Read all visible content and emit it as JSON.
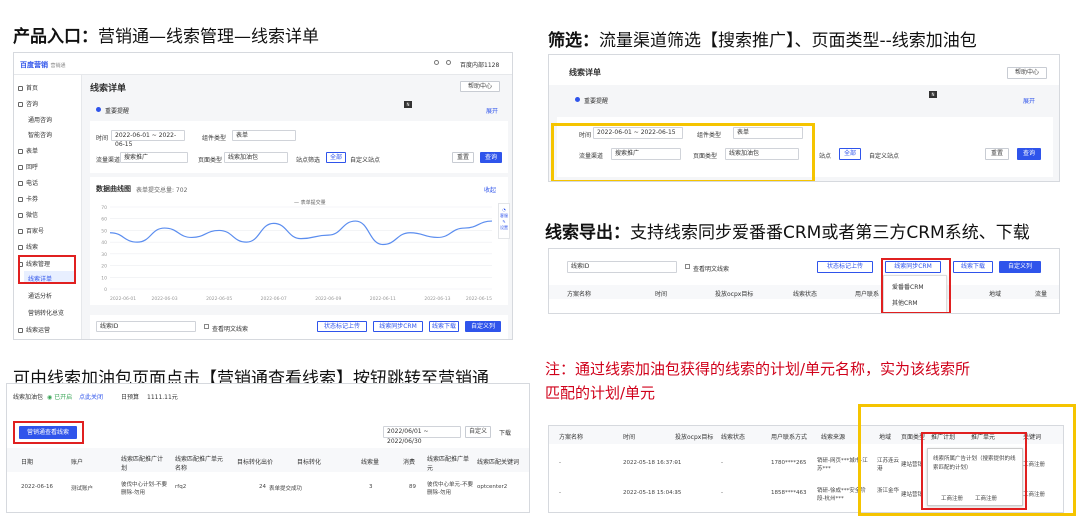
{
  "headings": {
    "product_entry_label": "产品入口：",
    "product_entry_path": "营销通—线索管理—线索详单",
    "filter_label": "筛选：",
    "filter_desc": "流量渠道筛选【搜索推广】、页面类型--线索加油包",
    "export_label": "线索导出：",
    "export_desc": "支持线索同步爱番番CRM或者第三方CRM系统、下载",
    "jump_desc": "可由线索加油包页面点击【营销通查看线索】按钮跳转至营销通",
    "note_line1": "注：通过线索加油包获得的线索的计划/单元名称，实为该线索所",
    "note_line2": "匹配的计划/单元"
  },
  "main_shot": {
    "logo": "百度营销",
    "logo_sub": "营销通",
    "user": "百度内部1128",
    "help": "帮助中心",
    "title": "线索详单",
    "notice": "重要提醒",
    "expand": "展开",
    "nav": [
      "首页",
      "咨询",
      "通用咨询",
      "智能咨询",
      "表单",
      "回呼",
      "电话",
      "卡券",
      "微信",
      "百家号",
      "线索",
      "线索管理",
      "线索详单",
      "通话分析",
      "营销转化总览",
      "线索运营"
    ],
    "filters": {
      "time_label": "时间",
      "time_value": "2022-06-01 ~ 2022-06-15",
      "component_label": "组件类型",
      "component_value": "表单",
      "channel_label": "流量渠道",
      "channel_value": "搜索推广",
      "page_type_label": "页面类型",
      "page_type_value": "线索加油包",
      "site_label": "站点筛选",
      "site_all": "全部",
      "site_custom": "自定义站点",
      "reset": "重置",
      "query": "查询"
    },
    "chart": {
      "title": "数据曲线图",
      "subtitle": "表单提交总量: 702",
      "collapse": "收起",
      "legend": "表单提交量",
      "side_a": "客服",
      "side_b": "设置"
    },
    "toolbar": {
      "search_select": "线索ID",
      "view_plain": "查看明文线索",
      "status": "状态标记上传",
      "sync": "线索同步CRM",
      "download": "线索下载",
      "custom": "自定义列"
    }
  },
  "chart_data": {
    "type": "line",
    "title": "",
    "x": [
      "2022-06-01",
      "2022-06-03",
      "2022-06-05",
      "2022-06-07",
      "2022-06-09",
      "2022-06-11",
      "2022-06-13",
      "2022-06-15"
    ],
    "series": [
      {
        "name": "表单提交量",
        "values": [
          48,
          40,
          52,
          44,
          50,
          40,
          56,
          43,
          46,
          58,
          38,
          48,
          44,
          52,
          58
        ]
      }
    ],
    "ylim": [
      0,
      70
    ],
    "yticks": [
      0,
      10,
      20,
      30,
      40,
      50,
      60,
      70
    ],
    "grid": true,
    "legend": "top"
  },
  "filter_shot": {
    "title": "线索详单",
    "help": "帮助中心",
    "notice": "重要提醒",
    "expand": "展开",
    "time_label": "时间",
    "time_value": "2022-06-01 ~ 2022-06-15",
    "component_label": "组件类型",
    "component_value": "表单",
    "channel_label": "流量渠道",
    "channel_value": "搜索推广",
    "page_type_label": "页面类型",
    "page_type_value": "线索加油包",
    "site_label": "站点",
    "site_all": "全部",
    "site_custom": "自定义站点",
    "reset": "重置",
    "query": "查询"
  },
  "export_shot": {
    "search_select": "线索ID",
    "view_plain": "查看明文线索",
    "status": "状态标记上传",
    "sync": "线索同步CRM",
    "download": "线索下载",
    "custom": "自定义列",
    "dropdown": [
      "爱番番CRM",
      "其他CRM"
    ],
    "cols": [
      "方案名称",
      "时间",
      "投放ocpx目标",
      "线索状态",
      "用户联系",
      "地域",
      "流量"
    ]
  },
  "jump_shot": {
    "page_label": "线索加油包",
    "status": "已开启",
    "status_link": "点此关闭",
    "budget_label": "日预算",
    "budget_value": "1111.11元",
    "view_button": "营销通查看线索",
    "date_range": "2022/06/01 ~ 2022/06/30",
    "custom": "自定义",
    "download": "下载",
    "cols": [
      "日期",
      "账户",
      "线索匹配推广计划",
      "线索匹配推广单元名称",
      "目标转化出价",
      "目标转化",
      "线索量",
      "消费",
      "线索匹配推广单元",
      "线索匹配关键词"
    ],
    "row": [
      "2022-06-16",
      "测试账户",
      "彼伐中心计划-不要删除-勿用",
      "rfq2",
      "24",
      "表单提交成功",
      "3",
      "89",
      "彼伐中心单元-不要删除-勿用",
      "optcenter2"
    ]
  },
  "note_shot": {
    "cols": [
      "方案名称",
      "时间",
      "投放ocpx目标",
      "线索状态",
      "用户联系方式",
      "线索来源",
      "地域",
      "页面类型",
      "推广计划",
      "推广单元",
      "关键词"
    ],
    "rows": [
      [
        "-",
        "2022-05-18 16:37:01",
        "-",
        "-",
        "1780****265",
        "销研-网页***城市-江苏***",
        "江苏连云港",
        "建站营销",
        "线索所属广告...",
        "工商注册"
      ],
      [
        "-",
        "2022-05-18 15:04:35",
        "-",
        "-",
        "1858****463",
        "销研-徐成***安全阶段-杭州***",
        "浙江金华",
        "建站营销",
        "工商注册",
        "工商注册"
      ]
    ],
    "popup": "线索所属广告计划（搜索提供的线索匹配的计划）",
    "popup_left": "工商注册",
    "popup_right": "工商注册",
    "kw_col": "关键词"
  }
}
